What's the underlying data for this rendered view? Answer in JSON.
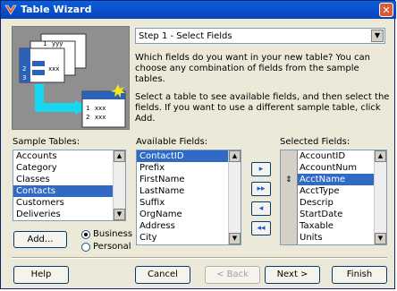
{
  "window": {
    "title": "Table Wizard",
    "close_label": "✕"
  },
  "step": {
    "selected": "Step 1 - Select Fields"
  },
  "description": {
    "p1": "Which fields do you want in your new table? You can choose any combination of fields from the sample tables.",
    "p2": "Select a table to see available fields, and then select the fields. If you want to use a different sample table, click Add."
  },
  "illustration": {
    "card_rows_top": [
      "1",
      "2",
      "3"
    ],
    "card_text": "yyy",
    "card_text2": "xxx"
  },
  "sample_tables": {
    "label": "Sample Tables:",
    "items": [
      "Accounts",
      "Category",
      "Classes",
      "Contacts",
      "Customers",
      "Deliveries"
    ],
    "selected_index": 3,
    "add_label": "Add...",
    "radio_business": "Business",
    "radio_personal": "Personal",
    "selected_radio": "Business"
  },
  "available_fields": {
    "label": "Available Fields:",
    "items": [
      "ContactID",
      "Prefix",
      "FirstName",
      "LastName",
      "Suffix",
      "OrgName",
      "Address",
      "City"
    ],
    "selected_index": 0
  },
  "move_buttons": {
    "add_one": "▸",
    "add_all": "▸▸",
    "remove_one": "◂",
    "remove_all": "◂◂"
  },
  "selected_fields": {
    "label": "Selected Fields:",
    "items": [
      "AccountID",
      "AccountNum",
      "AcctName",
      "AcctType",
      "Descrip",
      "StartDate",
      "Taxable",
      "Units"
    ],
    "selected_index": 2
  },
  "footer": {
    "help": "Help",
    "cancel": "Cancel",
    "back": "< Back",
    "next": "Next >",
    "finish": "Finish"
  },
  "colors": {
    "selection": "#316ac5",
    "title_bar": "#0a5fdc"
  }
}
